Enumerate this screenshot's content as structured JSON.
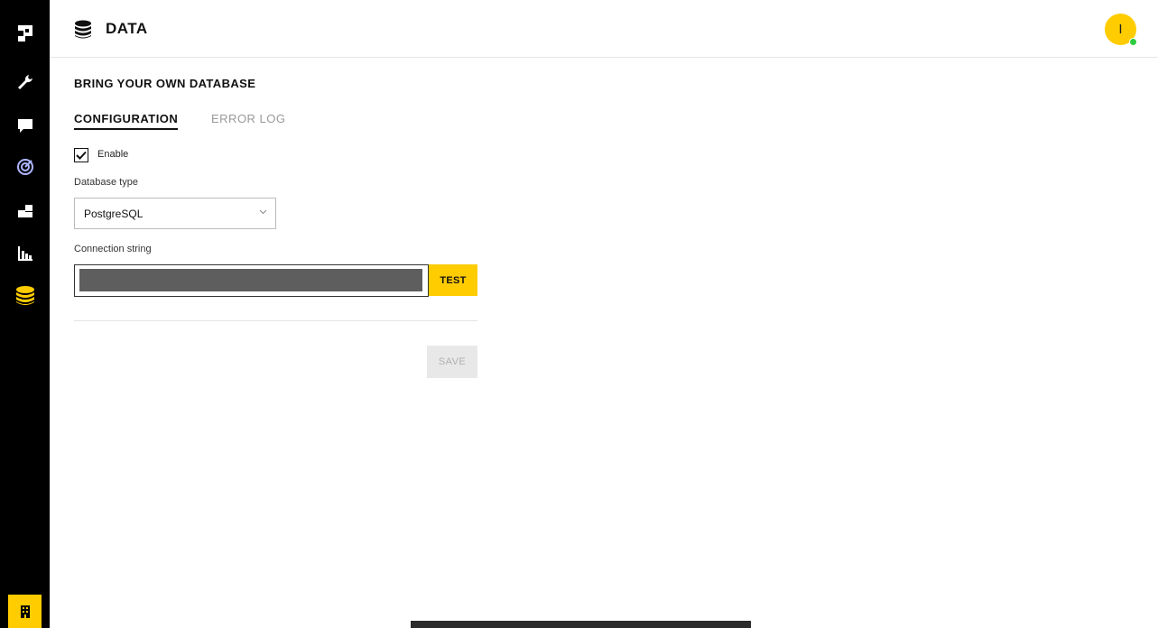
{
  "header": {
    "title": "DATA",
    "avatar_initial": "I"
  },
  "sidebar": {
    "items": [
      {
        "icon": "logo-icon"
      },
      {
        "icon": "wrench-icon"
      },
      {
        "icon": "chat-icon"
      },
      {
        "icon": "target-icon"
      },
      {
        "icon": "integrations-icon"
      },
      {
        "icon": "bar-chart-icon"
      },
      {
        "icon": "database-icon",
        "active": true
      }
    ],
    "bottom_icon": "building-icon"
  },
  "page": {
    "section_title": "BRING YOUR OWN DATABASE",
    "tabs": [
      {
        "label": "CONFIGURATION",
        "active": true
      },
      {
        "label": "ERROR LOG",
        "active": false
      }
    ],
    "enable": {
      "label": "Enable",
      "checked": true
    },
    "db_type": {
      "label": "Database type",
      "value": "PostgreSQL"
    },
    "connection": {
      "label": "Connection string",
      "test_label": "TEST"
    },
    "save_label": "SAVE"
  },
  "colors": {
    "accent": "#ffcc00",
    "sidebar_bg": "#000000",
    "status_online": "#2ecc40"
  }
}
